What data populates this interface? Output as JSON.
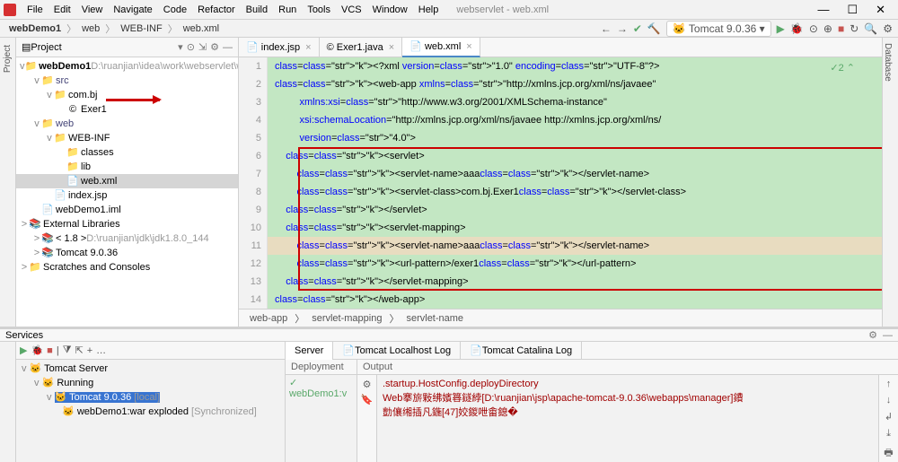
{
  "menu": {
    "items": [
      "File",
      "Edit",
      "View",
      "Navigate",
      "Code",
      "Refactor",
      "Build",
      "Run",
      "Tools",
      "VCS",
      "Window",
      "Help"
    ],
    "title": "webservlet - web.xml"
  },
  "breadcrumb": {
    "items": [
      "webDemo1",
      "web",
      "WEB-INF",
      "web.xml"
    ]
  },
  "toolbar": {
    "run_config": "Tomcat 9.0.36"
  },
  "project": {
    "title": "Project",
    "nodes": [
      {
        "ind": 0,
        "exp": "v",
        "ico": "📁",
        "label": "webDemo1",
        "suffix": " D:\\ruanjian\\idea\\work\\webservlet\\webDemo1",
        "bold": true
      },
      {
        "ind": 1,
        "exp": "v",
        "ico": "📁",
        "label": "src",
        "color": "#447"
      },
      {
        "ind": 2,
        "exp": "v",
        "ico": "📁",
        "label": "com.bj"
      },
      {
        "ind": 3,
        "exp": "",
        "ico": "©",
        "label": "Exer1"
      },
      {
        "ind": 1,
        "exp": "v",
        "ico": "📁",
        "label": "web",
        "color": "#447"
      },
      {
        "ind": 2,
        "exp": "v",
        "ico": "📁",
        "label": "WEB-INF"
      },
      {
        "ind": 3,
        "exp": "",
        "ico": "📁",
        "label": "classes"
      },
      {
        "ind": 3,
        "exp": "",
        "ico": "📁",
        "label": "lib"
      },
      {
        "ind": 3,
        "exp": "",
        "ico": "📄",
        "label": "web.xml",
        "selected": true
      },
      {
        "ind": 2,
        "exp": "",
        "ico": "📄",
        "label": "index.jsp"
      },
      {
        "ind": 1,
        "exp": "",
        "ico": "📄",
        "label": "webDemo1.iml"
      },
      {
        "ind": 0,
        "exp": ">",
        "ico": "📚",
        "label": "External Libraries"
      },
      {
        "ind": 1,
        "exp": ">",
        "ico": "📚",
        "label": "< 1.8 >",
        "suffix": " D:\\ruanjian\\jdk\\jdk1.8.0_144"
      },
      {
        "ind": 1,
        "exp": ">",
        "ico": "📚",
        "label": "Tomcat 9.0.36"
      },
      {
        "ind": 0,
        "exp": ">",
        "ico": "📁",
        "label": "Scratches and Consoles"
      }
    ]
  },
  "tabs": [
    {
      "icon": "📄",
      "label": "index.jsp",
      "active": false
    },
    {
      "icon": "©",
      "label": "Exer1.java",
      "active": false
    },
    {
      "icon": "📄",
      "label": "web.xml",
      "active": true
    }
  ],
  "code": {
    "check": "✓2 ⌃",
    "lines": [
      "<?xml version=\"1.0\" encoding=\"UTF-8\"?>",
      "<web-app xmlns=\"http://xmlns.jcp.org/xml/ns/javaee\"",
      "         xmlns:xsi=\"http://www.w3.org/2001/XMLSchema-instance\"",
      "         xsi:schemaLocation=\"http://xmlns.jcp.org/xml/ns/javaee http://xmlns.jcp.org/xml/ns/",
      "         version=\"4.0\">",
      "    <servlet>",
      "        <servlet-name>aaa</servlet-name>",
      "        <servlet-class>com.bj.Exer1</servlet-class>",
      "    </servlet>",
      "    <servlet-mapping>",
      "        <servlet-name>aaa</servlet-name>",
      "        <url-pattern>/exer1</url-pattern>",
      "    </servlet-mapping>",
      "</web-app>"
    ]
  },
  "bc2": [
    "web-app",
    "servlet-mapping",
    "servlet-name"
  ],
  "services": {
    "title": "Services",
    "tree": [
      {
        "ind": 0,
        "exp": "v",
        "label": "Tomcat Server"
      },
      {
        "ind": 1,
        "exp": "v",
        "label": "Running"
      },
      {
        "ind": 2,
        "exp": "v",
        "label": "Tomcat 9.0.36",
        "suffix": " [local]",
        "sel": true
      },
      {
        "ind": 3,
        "exp": "",
        "label": "webDemo1:war exploded",
        "suffix": " [Synchronized]"
      }
    ],
    "tabs": [
      "Server",
      "Tomcat Localhost Log",
      "Tomcat Catalina Log"
    ],
    "dep_hdr": "Deployment",
    "out_hdr": "Output",
    "dep_item": "✓ webDemo1:v",
    "console": [
      ".startup.HostConfig.deployDirectory",
      "Web搴旂敤绋嬪簭鐩綍[D:\\ruanjian\\jsp\\apache-tomcat-9.0.36\\webapps\\manager]鐨",
      "勯儴缃插凡鍦[47]姣鍐呭畬鎴�"
    ]
  }
}
